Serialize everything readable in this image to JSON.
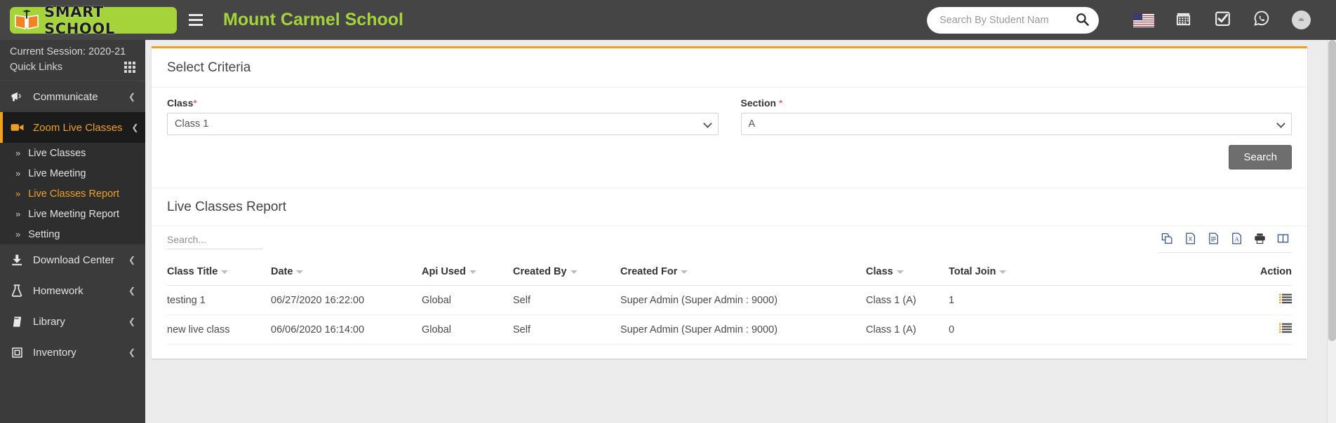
{
  "topbar": {
    "brand_text": "SMART SCHOOL",
    "school_title": "Mount Carmel School",
    "menu_toggle": "hamburger-menu",
    "search_placeholder": "Search By Student Nam",
    "search_value": "",
    "icons": [
      {
        "name": "language-flag-icon",
        "label": "US"
      },
      {
        "name": "calendar-icon",
        "label": "Calendar"
      },
      {
        "name": "task-check-icon",
        "label": "Tasks"
      },
      {
        "name": "whatsapp-icon",
        "label": "WhatsApp"
      },
      {
        "name": "user-avatar",
        "label": "Profile"
      }
    ]
  },
  "sidebar": {
    "session_label": "Current Session: 2020-21",
    "quick_links_label": "Quick Links",
    "items": [
      {
        "label": "Communicate",
        "icon": "megaphone-icon",
        "expandable": true,
        "active": false
      },
      {
        "label": "Zoom Live Classes",
        "icon": "video-camera-icon",
        "expandable": true,
        "active": true
      },
      {
        "label": "Download Center",
        "icon": "download-icon",
        "expandable": true,
        "active": false
      },
      {
        "label": "Homework",
        "icon": "flask-icon",
        "expandable": true,
        "active": false
      },
      {
        "label": "Library",
        "icon": "book-icon",
        "expandable": true,
        "active": false
      },
      {
        "label": "Inventory",
        "icon": "inventory-box-icon",
        "expandable": true,
        "active": false
      }
    ],
    "submenu": [
      {
        "label": "Live Classes",
        "active": false
      },
      {
        "label": "Live Meeting",
        "active": false
      },
      {
        "label": "Live Classes Report",
        "active": true
      },
      {
        "label": "Live Meeting Report",
        "active": false
      },
      {
        "label": "Setting",
        "active": false
      }
    ]
  },
  "criteria": {
    "title": "Select Criteria",
    "class_label": "Class",
    "class_required": "*",
    "class_value": "Class 1",
    "class_options": [
      "Class 1"
    ],
    "section_label": "Section",
    "section_required": "*",
    "section_value": "A",
    "section_options": [
      "A"
    ],
    "search_button": "Search"
  },
  "report": {
    "title": "Live Classes Report",
    "search_placeholder": "Search...",
    "search_value": "",
    "export_buttons": [
      {
        "name": "copy-export-icon",
        "label": "Copy"
      },
      {
        "name": "excel-export-icon",
        "label": "Excel"
      },
      {
        "name": "csv-export-icon",
        "label": "CSV"
      },
      {
        "name": "pdf-export-icon",
        "label": "PDF"
      },
      {
        "name": "print-icon",
        "label": "Print"
      },
      {
        "name": "column-visibility-icon",
        "label": "Column visibility"
      }
    ],
    "columns": [
      "Class Title",
      "Date",
      "Api Used",
      "Created By",
      "Created For",
      "Class",
      "Total Join",
      "Action"
    ],
    "rows": [
      {
        "class_title": "testing 1",
        "date": "06/27/2020 16:22:00",
        "api_used": "Global",
        "created_by": "Self",
        "created_for": "Super Admin (Super Admin : 9000)",
        "class": "Class 1 (A)",
        "total_join": "1",
        "action": "list-action-icon"
      },
      {
        "class_title": "new live class",
        "date": "06/06/2020 16:14:00",
        "api_used": "Global",
        "created_by": "Self",
        "created_for": "Super Admin (Super Admin : 9000)",
        "class": "Class 1 (A)",
        "total_join": "0",
        "action": "list-action-icon"
      }
    ]
  },
  "colors": {
    "accent": "#f0a020",
    "brand_green": "#a4d43a",
    "topbar_bg": "#454545",
    "sidebar_bg": "#3b3b3b",
    "active_bg": "#1b1b1b",
    "required_red": "#e23b3b"
  }
}
